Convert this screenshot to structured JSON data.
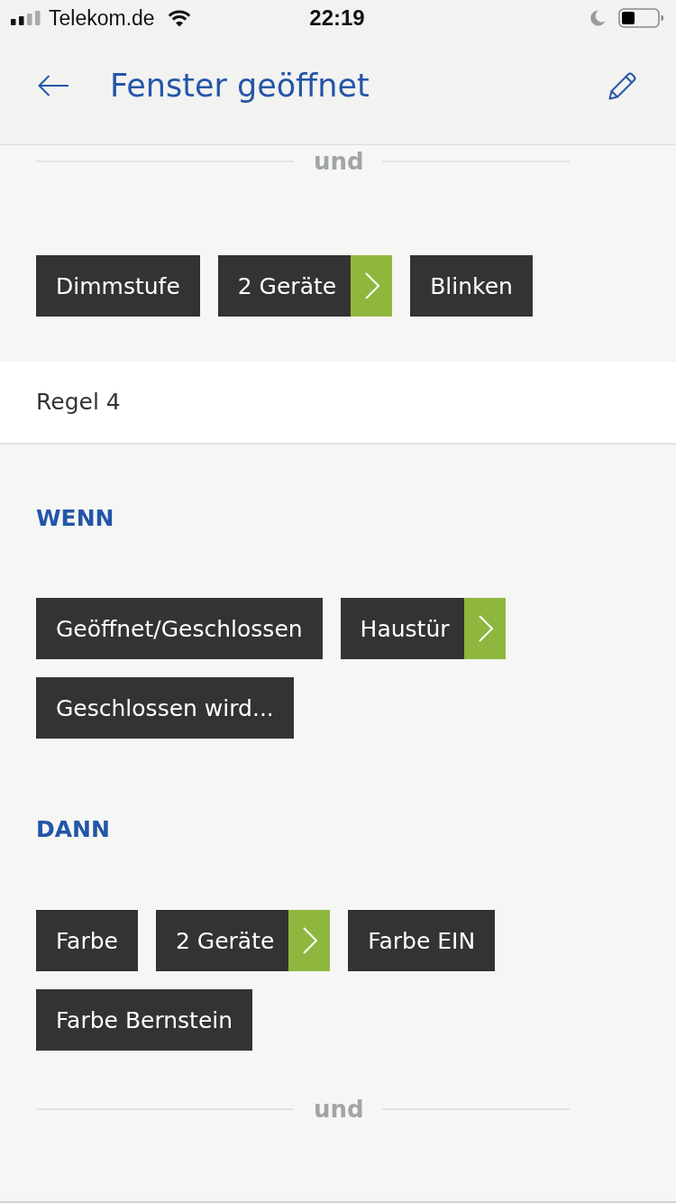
{
  "status_bar": {
    "carrier": "Telekom.de",
    "time": "22:19"
  },
  "header": {
    "title": "Fenster geöffnet"
  },
  "previous_rule": {
    "separator": "und",
    "actions": [
      {
        "label": "Dimmstufe",
        "kind": "plain"
      },
      {
        "label": "2 Geräte",
        "kind": "link"
      },
      {
        "label": "Blinken",
        "kind": "plain"
      }
    ]
  },
  "rule": {
    "title": "Regel 4",
    "sections": [
      {
        "heading": "WENN",
        "chips": [
          {
            "label": "Geöffnet/Geschlossen",
            "kind": "plain"
          },
          {
            "label": "Haustür",
            "kind": "link"
          },
          {
            "label": "Geschlossen wird...",
            "kind": "plain"
          }
        ]
      },
      {
        "heading": "DANN",
        "chips": [
          {
            "label": "Farbe",
            "kind": "plain"
          },
          {
            "label": "2 Geräte",
            "kind": "link"
          },
          {
            "label": "Farbe EIN",
            "kind": "plain"
          },
          {
            "label": "Farbe Bernstein",
            "kind": "plain"
          }
        ]
      }
    ],
    "separator": "und"
  }
}
